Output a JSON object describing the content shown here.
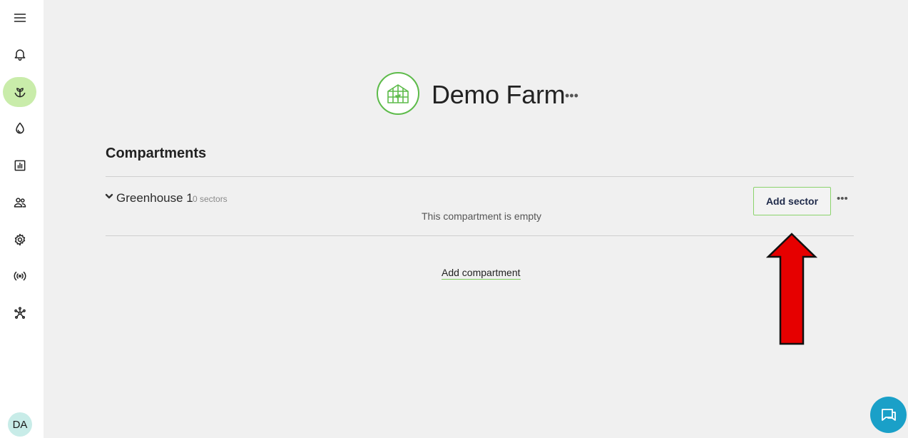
{
  "sidebar": {
    "items": [
      {
        "name": "menu",
        "icon": "hamburger-menu-icon"
      },
      {
        "name": "notifications",
        "icon": "bell-icon"
      },
      {
        "name": "crops",
        "icon": "sprout-icon",
        "active": true
      },
      {
        "name": "water",
        "icon": "water-drop-icon"
      },
      {
        "name": "reports",
        "icon": "bar-chart-icon"
      },
      {
        "name": "users",
        "icon": "users-icon"
      },
      {
        "name": "settings",
        "icon": "gear-icon"
      },
      {
        "name": "sensors",
        "icon": "broadcast-icon"
      },
      {
        "name": "network",
        "icon": "network-icon"
      }
    ],
    "avatar_initials": "DA"
  },
  "farm": {
    "name": "Demo Farm",
    "more_label": "•••",
    "logo_icon": "greenhouse-icon"
  },
  "compartments": {
    "title": "Compartments",
    "items": [
      {
        "name": "Greenhouse 1",
        "sector_count": "0 sectors",
        "empty_message": "This compartment is empty",
        "add_sector_label": "Add sector",
        "more_label": "•••"
      }
    ],
    "add_compartment_label": "Add compartment"
  },
  "colors": {
    "accent_green": "#5dbb4a",
    "active_nav_bg": "#c9ecaa",
    "chat_button": "#1aa0c8",
    "annotation_arrow": "#e60000"
  }
}
